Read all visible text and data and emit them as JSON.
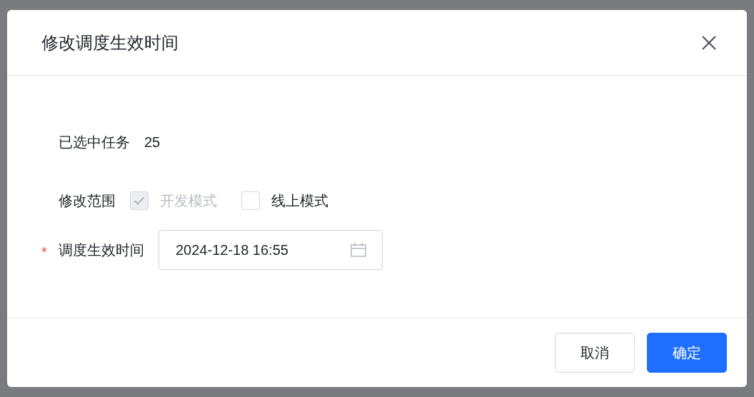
{
  "dialog": {
    "title": "修改调度生效时间",
    "fields": [
      {
        "kind": "text",
        "label": "已选中任务",
        "value": "25"
      },
      {
        "kind": "checkboxes",
        "label": "修改范围",
        "options": [
          {
            "label": "开发模式",
            "checked": true,
            "disabled": true
          },
          {
            "label": "线上模式",
            "checked": false,
            "disabled": false
          }
        ]
      },
      {
        "kind": "date",
        "label": "调度生效时间",
        "required_mark": "*",
        "value": "2024-12-18 16:55"
      }
    ],
    "buttons": [
      {
        "label": "取消",
        "primary": false
      },
      {
        "label": "确定",
        "primary": true
      }
    ]
  }
}
